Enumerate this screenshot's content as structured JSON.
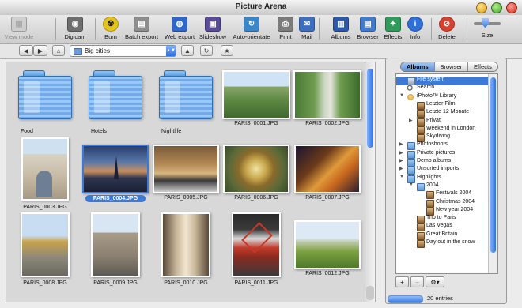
{
  "window": {
    "title": "Picture Arena"
  },
  "toolbar": {
    "items": [
      {
        "label": "View mode",
        "icon": "view-mode-icon",
        "enabled": false
      },
      {
        "label": "Digicam",
        "icon": "camera-icon",
        "enabled": true
      },
      {
        "label": "Burn",
        "icon": "burn-icon",
        "enabled": true
      },
      {
        "label": "Batch export",
        "icon": "batch-export-icon",
        "enabled": true
      },
      {
        "label": "Web export",
        "icon": "web-export-icon",
        "enabled": true
      },
      {
        "label": "Slideshow",
        "icon": "slideshow-icon",
        "enabled": true
      },
      {
        "label": "Auto-orientate",
        "icon": "auto-orientate-icon",
        "enabled": true
      },
      {
        "label": "Print",
        "icon": "printer-icon",
        "enabled": true
      },
      {
        "label": "Mail",
        "icon": "mail-icon",
        "enabled": true
      },
      {
        "label": "Albums",
        "icon": "albums-icon",
        "enabled": true
      },
      {
        "label": "Browser",
        "icon": "browser-icon",
        "enabled": true
      },
      {
        "label": "Effects",
        "icon": "effects-icon",
        "enabled": true
      },
      {
        "label": "Info",
        "icon": "info-icon",
        "enabled": true
      },
      {
        "label": "Delete",
        "icon": "delete-icon",
        "enabled": true
      },
      {
        "label": "Size",
        "icon": "size-slider-icon",
        "enabled": true
      }
    ]
  },
  "nav": {
    "path": "Big cities"
  },
  "grid": {
    "items": [
      {
        "type": "folder",
        "label": "Food"
      },
      {
        "type": "folder",
        "label": "Hotels"
      },
      {
        "type": "folder",
        "label": "Nightlife"
      },
      {
        "type": "photo",
        "label": "PARIS_0001.JPG",
        "scene": "garden"
      },
      {
        "type": "photo",
        "label": "PARIS_0002.JPG",
        "scene": "alley"
      },
      {
        "type": "photo",
        "label": "PARIS_0003.JPG",
        "scene": "arch"
      },
      {
        "type": "photo",
        "label": "PARIS_0004.JPG",
        "scene": "dusk",
        "selected": true
      },
      {
        "type": "photo",
        "label": "PARIS_0005.JPG",
        "scene": "hall"
      },
      {
        "type": "photo",
        "label": "PARIS_0006.JPG",
        "scene": "dome"
      },
      {
        "type": "photo",
        "label": "PARIS_0007.JPG",
        "scene": "night"
      },
      {
        "type": "photo",
        "label": "PARIS_0008.JPG",
        "scene": "invalides"
      },
      {
        "type": "photo",
        "label": "PARIS_0009.JPG",
        "scene": "church"
      },
      {
        "type": "photo",
        "label": "PARIS_0010.JPG",
        "scene": "nave"
      },
      {
        "type": "photo",
        "label": "PARIS_0011.JPG",
        "scene": "moulin"
      },
      {
        "type": "photo",
        "label": "PARIS_0012.JPG",
        "scene": "park"
      }
    ]
  },
  "drawer": {
    "tabs": [
      "Albums",
      "Browser",
      "Effects"
    ],
    "active_tab": "Albums",
    "tree": [
      {
        "label": "File system",
        "level": 1,
        "icon": "disk-icon",
        "selected": true
      },
      {
        "label": "Search",
        "level": 1,
        "icon": "search-icon"
      },
      {
        "label": "iPhoto™ Library",
        "level": 1,
        "icon": "iphoto-icon",
        "toggle": "open"
      },
      {
        "label": "Letzter Film",
        "level": 2,
        "icon": "album-icon"
      },
      {
        "label": "Letzte 12 Monate",
        "level": 2,
        "icon": "album-icon"
      },
      {
        "label": "Privat",
        "level": 2,
        "icon": "album-icon",
        "toggle": "closed"
      },
      {
        "label": "Weekend in London",
        "level": 2,
        "icon": "album-icon"
      },
      {
        "label": "Skydiving",
        "level": 2,
        "icon": "album-icon"
      },
      {
        "label": "Photoshoots",
        "level": 1,
        "icon": "folder-icon",
        "toggle": "closed"
      },
      {
        "label": "Private pictures",
        "level": 1,
        "icon": "folder-icon",
        "toggle": "closed"
      },
      {
        "label": "Demo albums",
        "level": 1,
        "icon": "folder-icon",
        "toggle": "closed"
      },
      {
        "label": "Unsorted imports",
        "level": 1,
        "icon": "folder-icon",
        "toggle": "closed"
      },
      {
        "label": "Highlights",
        "level": 1,
        "icon": "folder-icon",
        "toggle": "open"
      },
      {
        "label": "2004",
        "level": 2,
        "icon": "folder-icon",
        "toggle": "open"
      },
      {
        "label": "Festivals 2004",
        "level": 3,
        "icon": "album-icon"
      },
      {
        "label": "Christmas 2004",
        "level": 3,
        "icon": "album-icon"
      },
      {
        "label": "New year 2004",
        "level": 3,
        "icon": "album-icon"
      },
      {
        "label": "Trip to Paris",
        "level": 2,
        "icon": "album-icon"
      },
      {
        "label": "Las Vegas",
        "level": 2,
        "icon": "album-icon"
      },
      {
        "label": "Great Britain",
        "level": 2,
        "icon": "album-icon"
      },
      {
        "label": "Day out in the snow",
        "level": 2,
        "icon": "album-icon"
      }
    ]
  },
  "status": {
    "entries": "20 entries"
  }
}
